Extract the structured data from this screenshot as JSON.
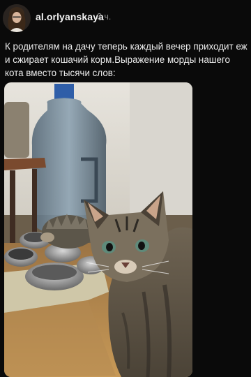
{
  "post": {
    "username": "al.orlyanskaya",
    "timestamp": "3 ч.",
    "text": "К родителям на дачу теперь каждый вечер приходит еж и сжирает кошачий корм.Выражение морды нашего кота вместо тысячи слов:"
  },
  "icons": {
    "avatar": "profile-photo-avatar",
    "photo": "cat-and-hedgehog-photo"
  }
}
